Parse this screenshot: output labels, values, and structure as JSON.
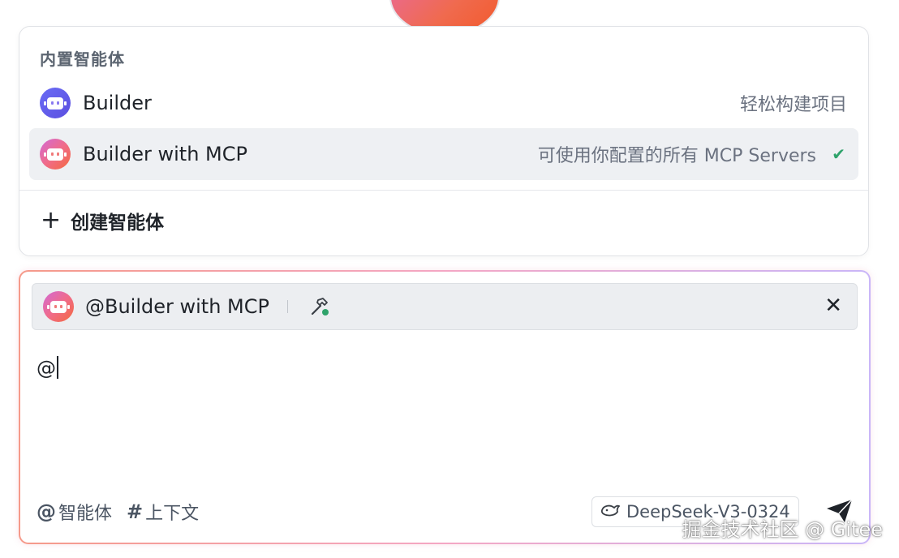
{
  "popup": {
    "title": "内置智能体",
    "agents": [
      {
        "name": "Builder",
        "description": "轻松构建项目",
        "selected": false
      },
      {
        "name": "Builder with MCP",
        "description": "可使用你配置的所有 MCP Servers",
        "selected": true
      }
    ],
    "create_label": "创建智能体"
  },
  "composer": {
    "chip_label": "@Builder with MCP",
    "typed_text": "@",
    "mention_label": "智能体",
    "context_label": "上下文",
    "model_label": "DeepSeek-V3-0324"
  },
  "watermark": "掘金技术社区 @ Gitee",
  "colors": {
    "accent_purple": "#6a6cf5",
    "check_green": "#2fa36b",
    "selected_bg": "#eef0f3"
  }
}
